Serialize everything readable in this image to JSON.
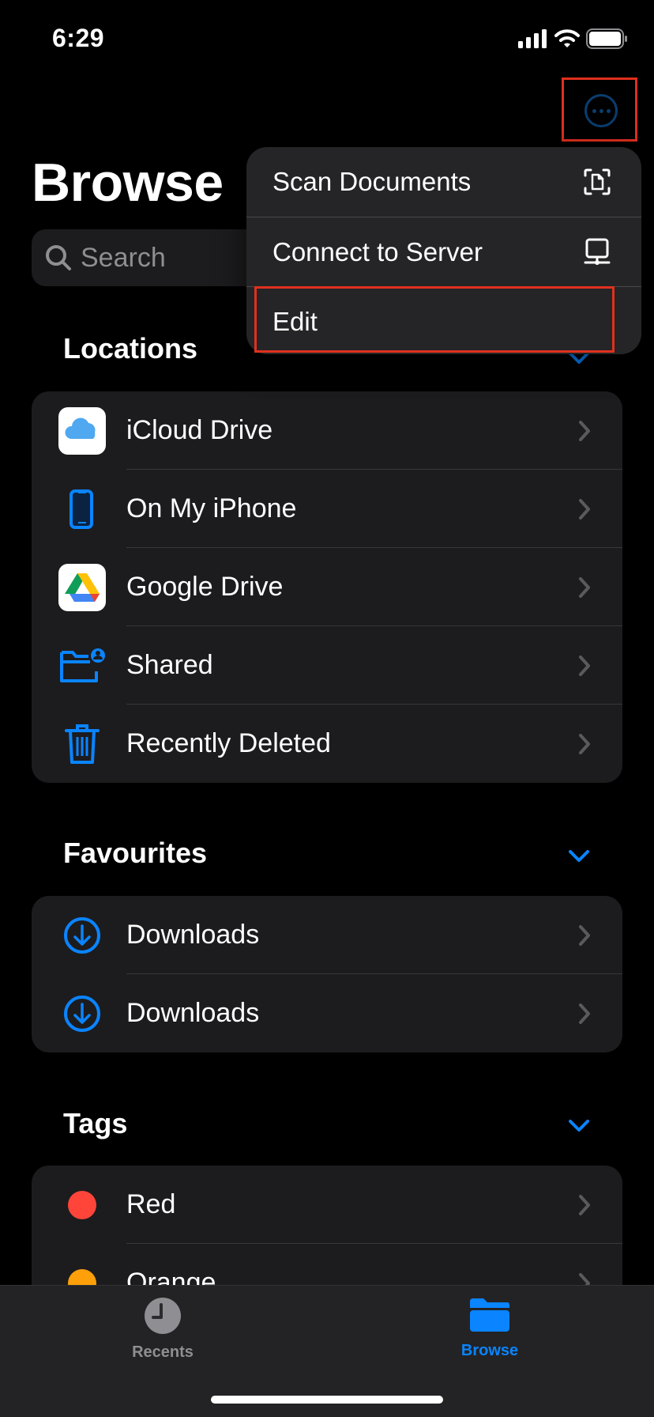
{
  "status_bar": {
    "time": "6:29",
    "icons": [
      "cellular-signal-icon",
      "wifi-icon",
      "battery-icon"
    ]
  },
  "header": {
    "title": "Browse",
    "more_button": "more-icon"
  },
  "search": {
    "placeholder": "Search"
  },
  "menu": {
    "items": [
      {
        "label": "Scan Documents",
        "icon": "scan-document-icon"
      },
      {
        "label": "Connect to Server",
        "icon": "server-icon"
      },
      {
        "label": "Edit",
        "icon": ""
      }
    ]
  },
  "sections": {
    "locations": {
      "title": "Locations",
      "items": [
        {
          "label": "iCloud Drive",
          "icon": "icloud-icon"
        },
        {
          "label": "On My iPhone",
          "icon": "iphone-icon"
        },
        {
          "label": "Google Drive",
          "icon": "google-drive-icon"
        },
        {
          "label": "Shared",
          "icon": "shared-folder-icon"
        },
        {
          "label": "Recently Deleted",
          "icon": "trash-icon"
        }
      ]
    },
    "favourites": {
      "title": "Favourites",
      "items": [
        {
          "label": "Downloads",
          "icon": "download-circle-icon"
        },
        {
          "label": "Downloads",
          "icon": "download-circle-icon"
        }
      ]
    },
    "tags": {
      "title": "Tags",
      "items": [
        {
          "label": "Red",
          "color": "#ff453a"
        },
        {
          "label": "Orange",
          "color": "#ff9f0a"
        }
      ]
    }
  },
  "tabbar": {
    "tabs": [
      {
        "label": "Recents",
        "icon": "clock-icon",
        "active": false
      },
      {
        "label": "Browse",
        "icon": "folder-icon",
        "active": true
      }
    ]
  },
  "colors": {
    "accent": "#0a84ff",
    "highlight": "#e0301e",
    "background": "#000000",
    "card": "#1c1c1e"
  }
}
